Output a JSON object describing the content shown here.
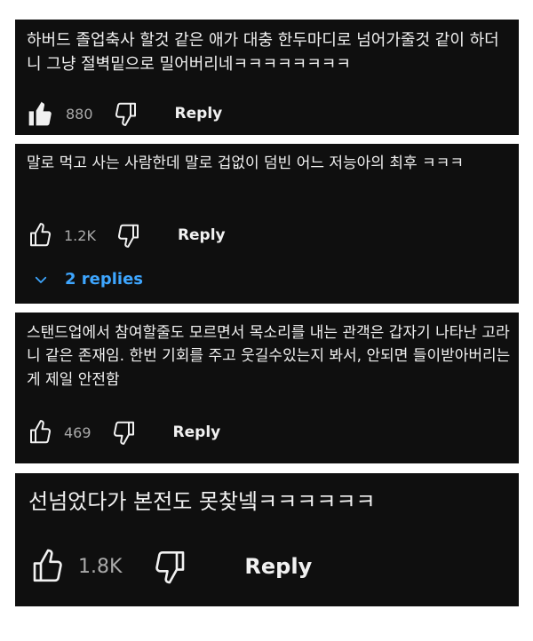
{
  "comments": [
    {
      "text": "하버드 졸업축사 할것 같은 애가 대충 한두마디로 넘어가줄것 같이 하더니 그냥 절벽밑으로 밀어버리네ㅋㅋㅋㅋㅋㅋㅋㅋ",
      "likes": "880",
      "liked": true,
      "reply_label": "Reply"
    },
    {
      "text": "말로 먹고 사는 사람한데 말로 겁없이 덤빈 어느 저능아의 최후 ㅋㅋㅋ",
      "likes": "1.2K",
      "liked": false,
      "reply_label": "Reply",
      "replies_label": "2 replies"
    },
    {
      "text": "스탠드업에서 참여할줄도 모르면서 목소리를 내는 관객은 갑자기 나타난 고라니 같은 존재임. 한번 기회를 주고 웃길수있는지 봐서, 안되면 들이받아버리는게 제일 안전함",
      "likes": "469",
      "liked": false,
      "reply_label": "Reply"
    },
    {
      "text": "선넘었다가 본전도 못찾넼ㅋㅋㅋㅋㅋㅋ",
      "likes": "1.8K",
      "liked": false,
      "reply_label": "Reply"
    }
  ],
  "icons": {
    "like": "thumbs-up-icon",
    "dislike": "thumbs-down-icon",
    "expand": "chevron-down-icon"
  },
  "colors": {
    "card_bg": "#0f0f0f",
    "text": "#f1f1f1",
    "muted": "#aaaaaa",
    "link": "#3ea6ff"
  }
}
